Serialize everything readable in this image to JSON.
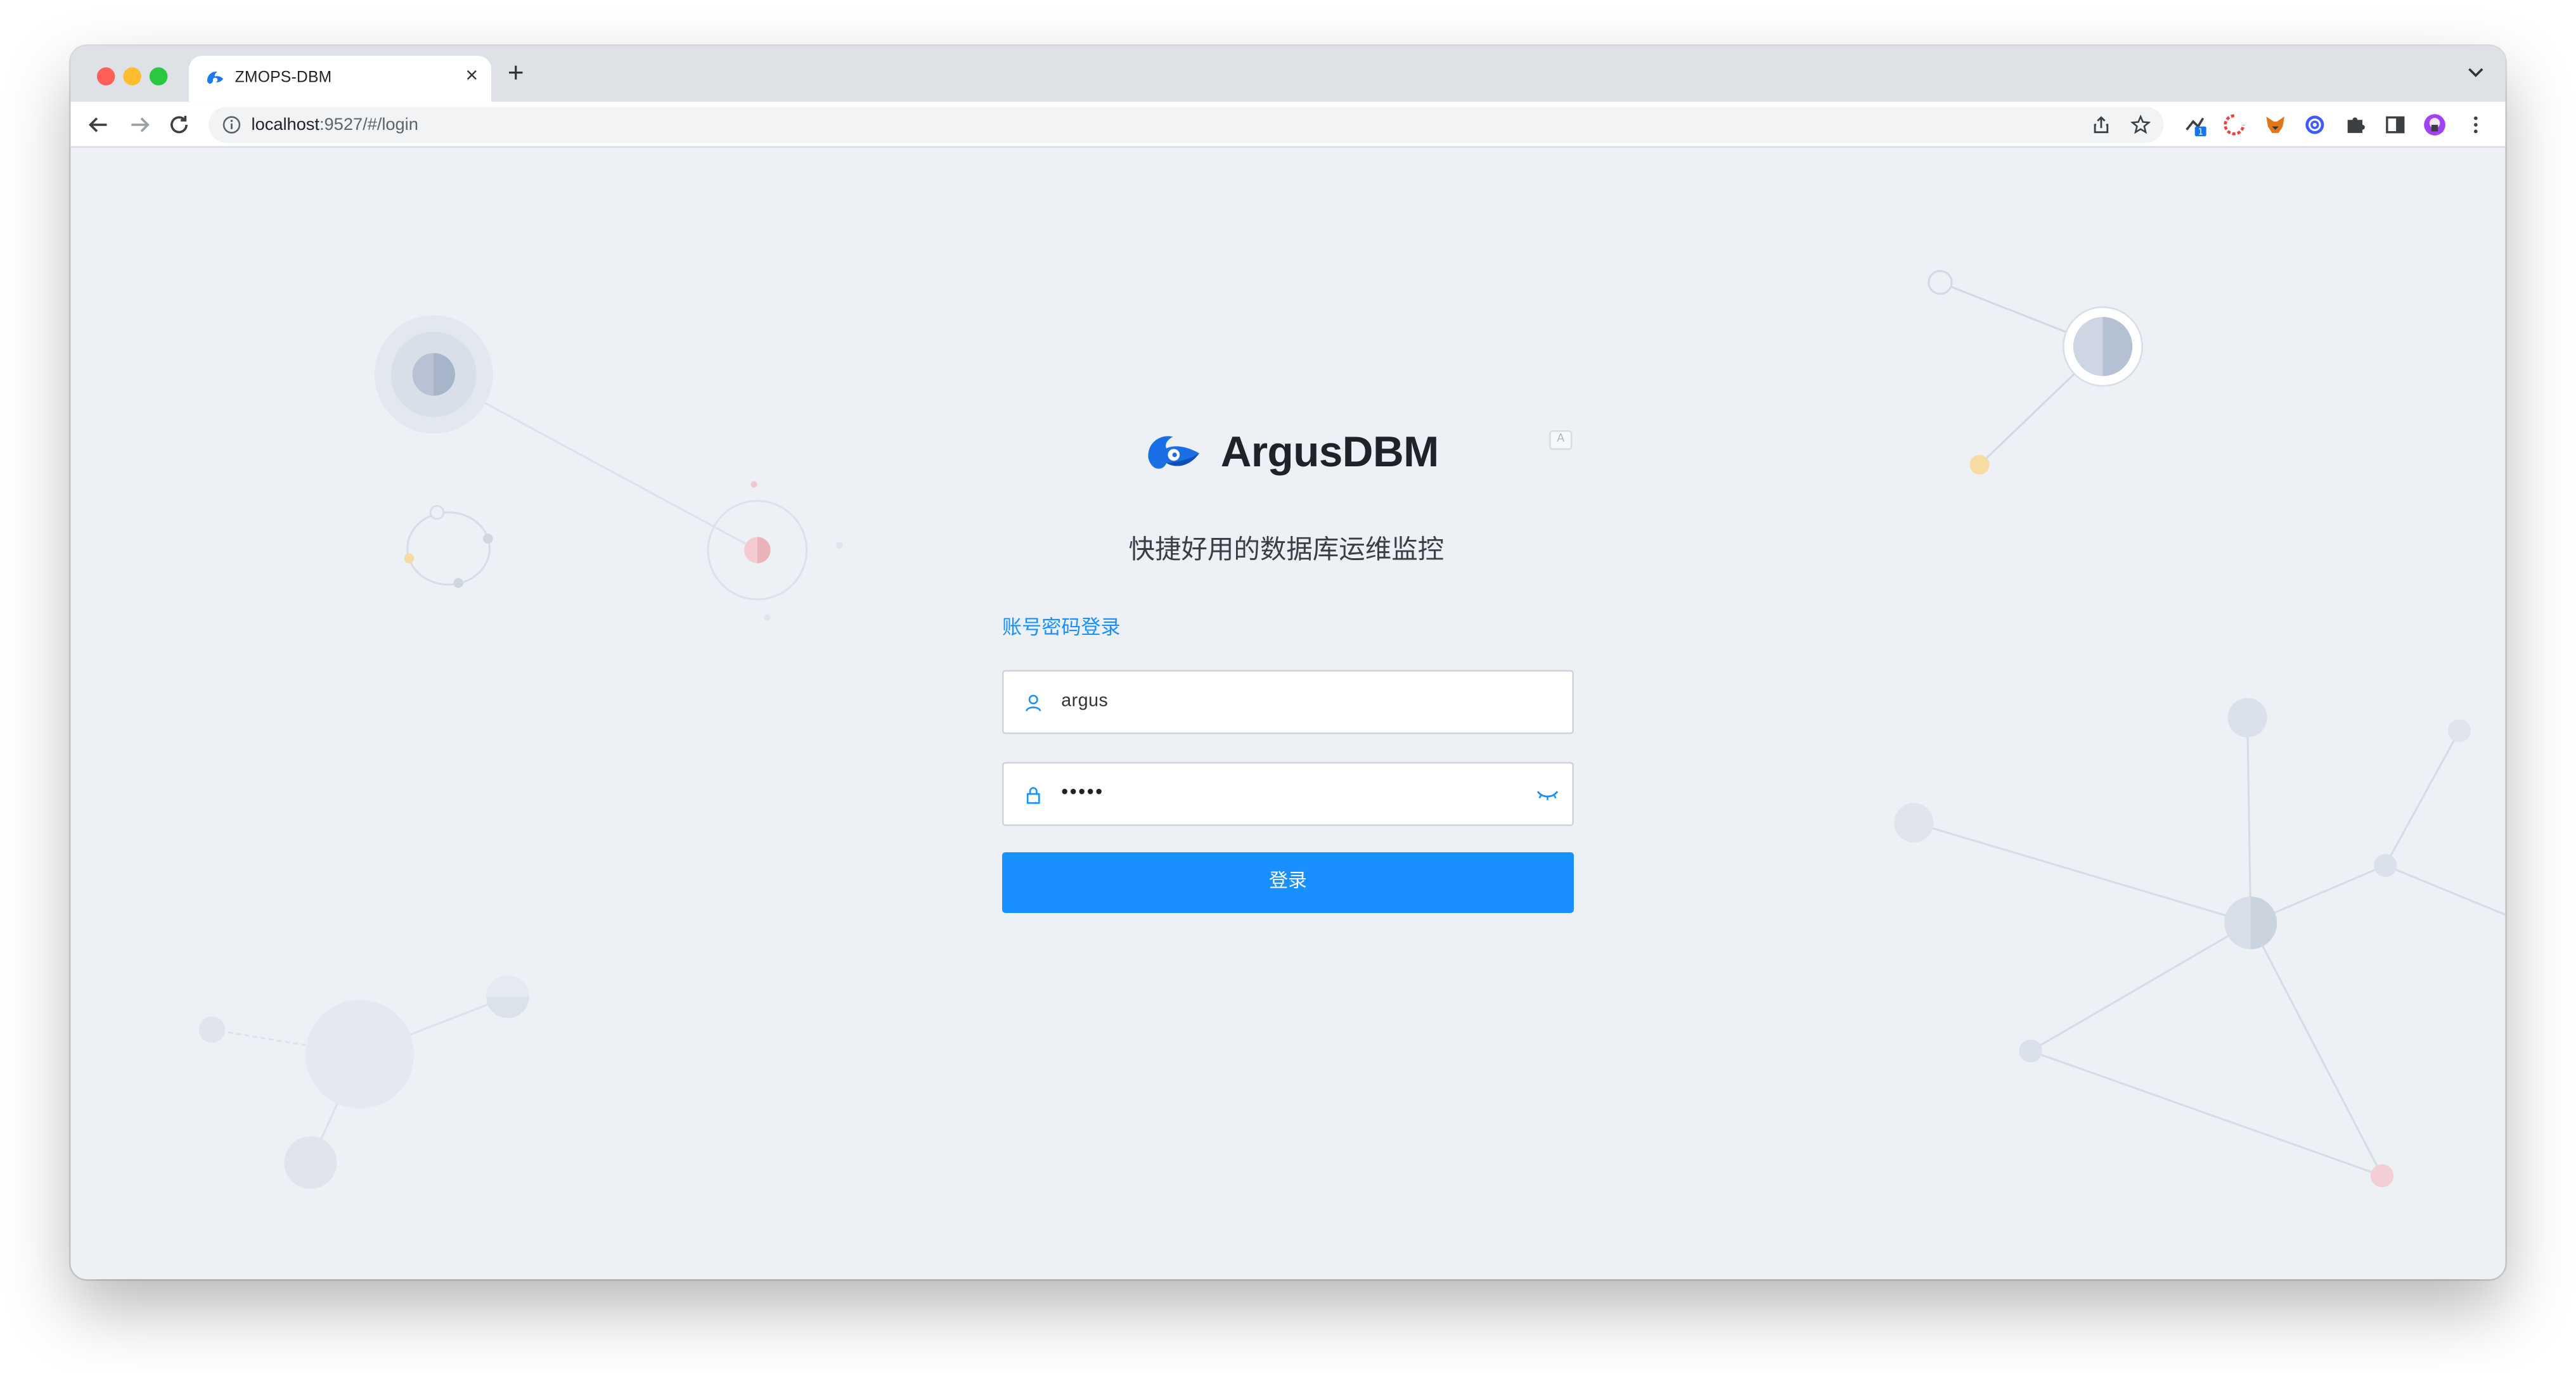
{
  "browser": {
    "tab_title": "ZMOPS-DBM",
    "tab_close": "×",
    "new_tab": "+",
    "url_host": "localhost",
    "url_path": ":9527/#/login",
    "icons": {
      "back": "arrow-left-icon",
      "forward": "arrow-right-icon",
      "reload": "reload-icon",
      "site_info": "info-icon",
      "share": "share-icon",
      "bookmark": "star-icon",
      "extensions": [
        "extension-badge-icon",
        "extension-red-icon",
        "metamask-fox-icon",
        "extension-blue-icon",
        "puzzle-icon",
        "side-panel-icon",
        "profile-avatar",
        "kebab-menu-icon"
      ]
    },
    "badge_count": "1"
  },
  "app": {
    "brand": "ArgusDBM",
    "subtitle": "快捷好用的数据库运维监控",
    "login_tab": "账号密码登录",
    "username": "argus",
    "password_mask": "•••••",
    "login_button": "登录",
    "colors": {
      "primary": "#1890ff",
      "background": "#edf0f5",
      "text": "#1f2329"
    }
  }
}
